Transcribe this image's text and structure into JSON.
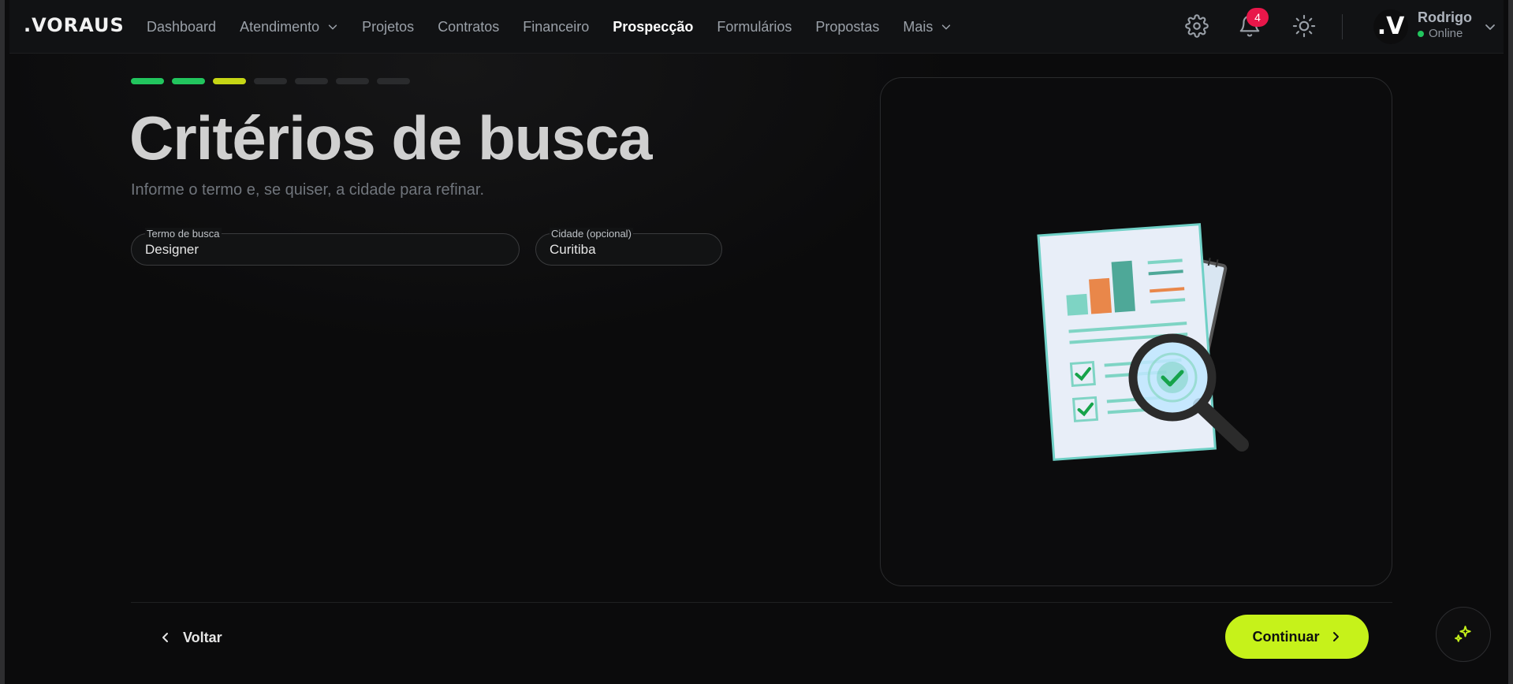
{
  "app": {
    "logo": ".VORAUS"
  },
  "nav": {
    "items": [
      {
        "label": "Dashboard",
        "dropdown": false,
        "active": false
      },
      {
        "label": "Atendimento",
        "dropdown": true,
        "active": false
      },
      {
        "label": "Projetos",
        "dropdown": false,
        "active": false
      },
      {
        "label": "Contratos",
        "dropdown": false,
        "active": false
      },
      {
        "label": "Financeiro",
        "dropdown": false,
        "active": false
      },
      {
        "label": "Prospecção",
        "dropdown": false,
        "active": true
      },
      {
        "label": "Formulários",
        "dropdown": false,
        "active": false
      },
      {
        "label": "Propostas",
        "dropdown": false,
        "active": false
      },
      {
        "label": "Mais",
        "dropdown": true,
        "active": false
      }
    ]
  },
  "header": {
    "notifications_count": "4",
    "avatar_letter": ".V",
    "user_name": "Rodrigo",
    "user_status": "Online"
  },
  "stepper": {
    "total": 7,
    "completed": 2,
    "current": 3,
    "colors": {
      "completed": "#22c55e",
      "current": "#c6d615",
      "pending": "#2a2b2d"
    }
  },
  "page": {
    "title": "Critérios de busca",
    "subtitle": "Informe o termo e, se quiser, a cidade para refinar."
  },
  "form": {
    "term": {
      "label": "Termo de busca",
      "value": "Designer"
    },
    "city": {
      "label": "Cidade (opcional)",
      "value": "Curitiba"
    }
  },
  "footer": {
    "back_label": "Voltar",
    "continue_label": "Continuar"
  },
  "colors": {
    "accent": "#c6f21a",
    "badge": "#e8174a",
    "online": "#22c55e"
  }
}
